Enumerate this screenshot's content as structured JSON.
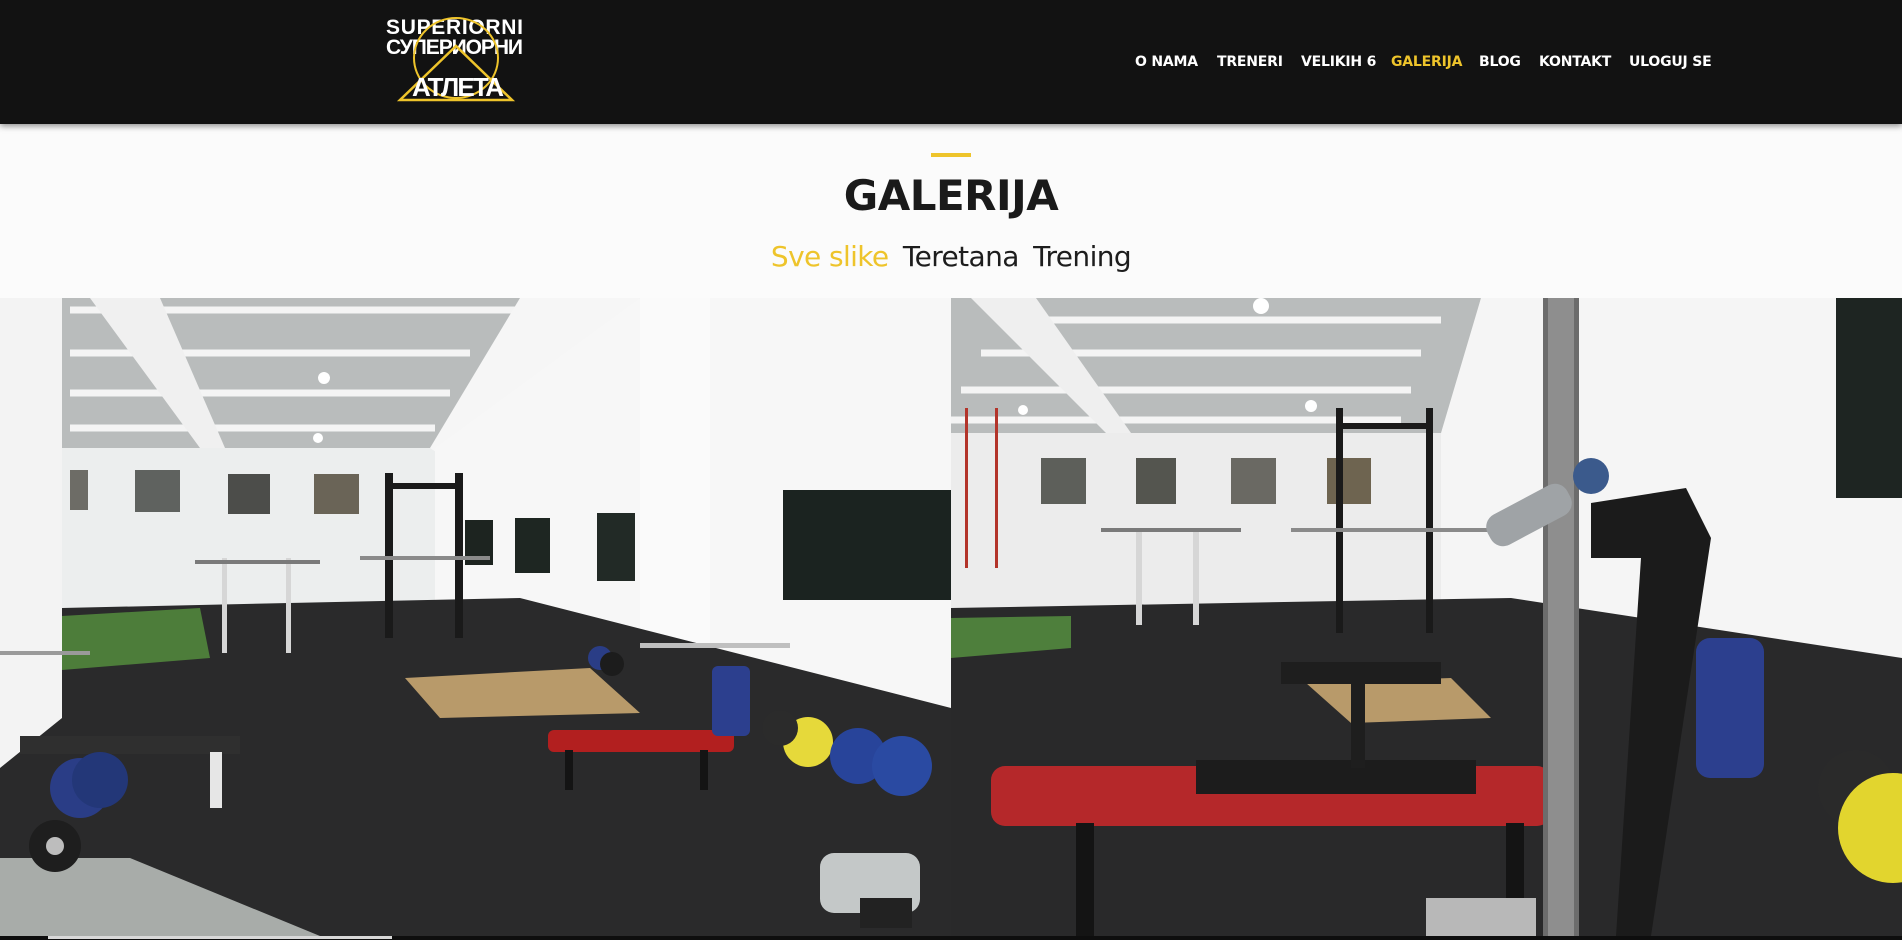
{
  "logo": {
    "line1": "SUPERIORNI",
    "line2": "СУПЕРИОРНИ",
    "line3": "АТЛЕТА",
    "accent_color": "#eec42b"
  },
  "nav": {
    "items": [
      {
        "label": "O NAMA"
      },
      {
        "label": "TRENERI"
      },
      {
        "label": "VELIKIH 6"
      },
      {
        "label": "GALERIJA"
      },
      {
        "label": "BLOG"
      },
      {
        "label": "KONTAKT"
      },
      {
        "label": "ULOGUJ SE"
      }
    ],
    "active": "GALERIJA"
  },
  "page": {
    "title": "GALERIJA"
  },
  "filters": {
    "items": [
      {
        "label": "Sve slike"
      },
      {
        "label": "Teretana"
      },
      {
        "label": "Trening"
      }
    ],
    "active": "Sve slike"
  },
  "colors": {
    "accent": "#eec42b",
    "header_bg": "#121212",
    "title_bg": "#fbfbfb"
  },
  "gallery": {
    "images": [
      {
        "icon": "gym-interior-photo"
      },
      {
        "icon": "gym-bench-closeup-photo"
      }
    ]
  }
}
